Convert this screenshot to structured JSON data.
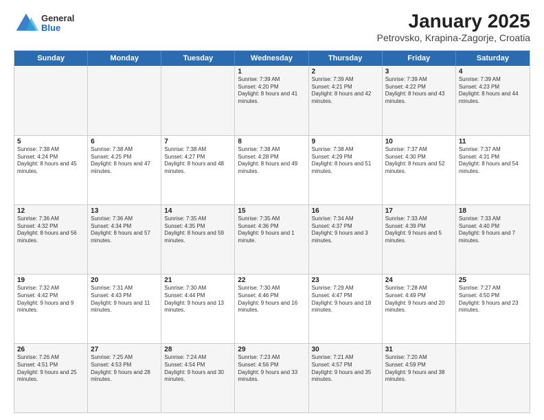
{
  "header": {
    "logo_general": "General",
    "logo_blue": "Blue",
    "title": "January 2025",
    "subtitle": "Petrovsko, Krapina-Zagorje, Croatia"
  },
  "days": [
    "Sunday",
    "Monday",
    "Tuesday",
    "Wednesday",
    "Thursday",
    "Friday",
    "Saturday"
  ],
  "weeks": [
    [
      {
        "day": "",
        "info": ""
      },
      {
        "day": "",
        "info": ""
      },
      {
        "day": "",
        "info": ""
      },
      {
        "day": "1",
        "info": "Sunrise: 7:39 AM\nSunset: 4:20 PM\nDaylight: 8 hours and 41 minutes."
      },
      {
        "day": "2",
        "info": "Sunrise: 7:39 AM\nSunset: 4:21 PM\nDaylight: 8 hours and 42 minutes."
      },
      {
        "day": "3",
        "info": "Sunrise: 7:39 AM\nSunset: 4:22 PM\nDaylight: 8 hours and 43 minutes."
      },
      {
        "day": "4",
        "info": "Sunrise: 7:39 AM\nSunset: 4:23 PM\nDaylight: 8 hours and 44 minutes."
      }
    ],
    [
      {
        "day": "5",
        "info": "Sunrise: 7:38 AM\nSunset: 4:24 PM\nDaylight: 8 hours and 45 minutes."
      },
      {
        "day": "6",
        "info": "Sunrise: 7:38 AM\nSunset: 4:25 PM\nDaylight: 8 hours and 47 minutes."
      },
      {
        "day": "7",
        "info": "Sunrise: 7:38 AM\nSunset: 4:27 PM\nDaylight: 8 hours and 48 minutes."
      },
      {
        "day": "8",
        "info": "Sunrise: 7:38 AM\nSunset: 4:28 PM\nDaylight: 8 hours and 49 minutes."
      },
      {
        "day": "9",
        "info": "Sunrise: 7:38 AM\nSunset: 4:29 PM\nDaylight: 8 hours and 51 minutes."
      },
      {
        "day": "10",
        "info": "Sunrise: 7:37 AM\nSunset: 4:30 PM\nDaylight: 8 hours and 52 minutes."
      },
      {
        "day": "11",
        "info": "Sunrise: 7:37 AM\nSunset: 4:31 PM\nDaylight: 8 hours and 54 minutes."
      }
    ],
    [
      {
        "day": "12",
        "info": "Sunrise: 7:36 AM\nSunset: 4:32 PM\nDaylight: 8 hours and 56 minutes."
      },
      {
        "day": "13",
        "info": "Sunrise: 7:36 AM\nSunset: 4:34 PM\nDaylight: 8 hours and 57 minutes."
      },
      {
        "day": "14",
        "info": "Sunrise: 7:35 AM\nSunset: 4:35 PM\nDaylight: 8 hours and 59 minutes."
      },
      {
        "day": "15",
        "info": "Sunrise: 7:35 AM\nSunset: 4:36 PM\nDaylight: 9 hours and 1 minute."
      },
      {
        "day": "16",
        "info": "Sunrise: 7:34 AM\nSunset: 4:37 PM\nDaylight: 9 hours and 3 minutes."
      },
      {
        "day": "17",
        "info": "Sunrise: 7:33 AM\nSunset: 4:39 PM\nDaylight: 9 hours and 5 minutes."
      },
      {
        "day": "18",
        "info": "Sunrise: 7:33 AM\nSunset: 4:40 PM\nDaylight: 9 hours and 7 minutes."
      }
    ],
    [
      {
        "day": "19",
        "info": "Sunrise: 7:32 AM\nSunset: 4:42 PM\nDaylight: 9 hours and 9 minutes."
      },
      {
        "day": "20",
        "info": "Sunrise: 7:31 AM\nSunset: 4:43 PM\nDaylight: 9 hours and 11 minutes."
      },
      {
        "day": "21",
        "info": "Sunrise: 7:30 AM\nSunset: 4:44 PM\nDaylight: 9 hours and 13 minutes."
      },
      {
        "day": "22",
        "info": "Sunrise: 7:30 AM\nSunset: 4:46 PM\nDaylight: 9 hours and 16 minutes."
      },
      {
        "day": "23",
        "info": "Sunrise: 7:29 AM\nSunset: 4:47 PM\nDaylight: 9 hours and 18 minutes."
      },
      {
        "day": "24",
        "info": "Sunrise: 7:28 AM\nSunset: 4:49 PM\nDaylight: 9 hours and 20 minutes."
      },
      {
        "day": "25",
        "info": "Sunrise: 7:27 AM\nSunset: 4:50 PM\nDaylight: 9 hours and 23 minutes."
      }
    ],
    [
      {
        "day": "26",
        "info": "Sunrise: 7:26 AM\nSunset: 4:51 PM\nDaylight: 9 hours and 25 minutes."
      },
      {
        "day": "27",
        "info": "Sunrise: 7:25 AM\nSunset: 4:53 PM\nDaylight: 9 hours and 28 minutes."
      },
      {
        "day": "28",
        "info": "Sunrise: 7:24 AM\nSunset: 4:54 PM\nDaylight: 9 hours and 30 minutes."
      },
      {
        "day": "29",
        "info": "Sunrise: 7:23 AM\nSunset: 4:56 PM\nDaylight: 9 hours and 33 minutes."
      },
      {
        "day": "30",
        "info": "Sunrise: 7:21 AM\nSunset: 4:57 PM\nDaylight: 9 hours and 35 minutes."
      },
      {
        "day": "31",
        "info": "Sunrise: 7:20 AM\nSunset: 4:59 PM\nDaylight: 9 hours and 38 minutes."
      },
      {
        "day": "",
        "info": ""
      }
    ]
  ],
  "shaded_rows": [
    0,
    2,
    4
  ],
  "first_row_empty": [
    0,
    1,
    2
  ],
  "last_row_empty": [
    6
  ]
}
